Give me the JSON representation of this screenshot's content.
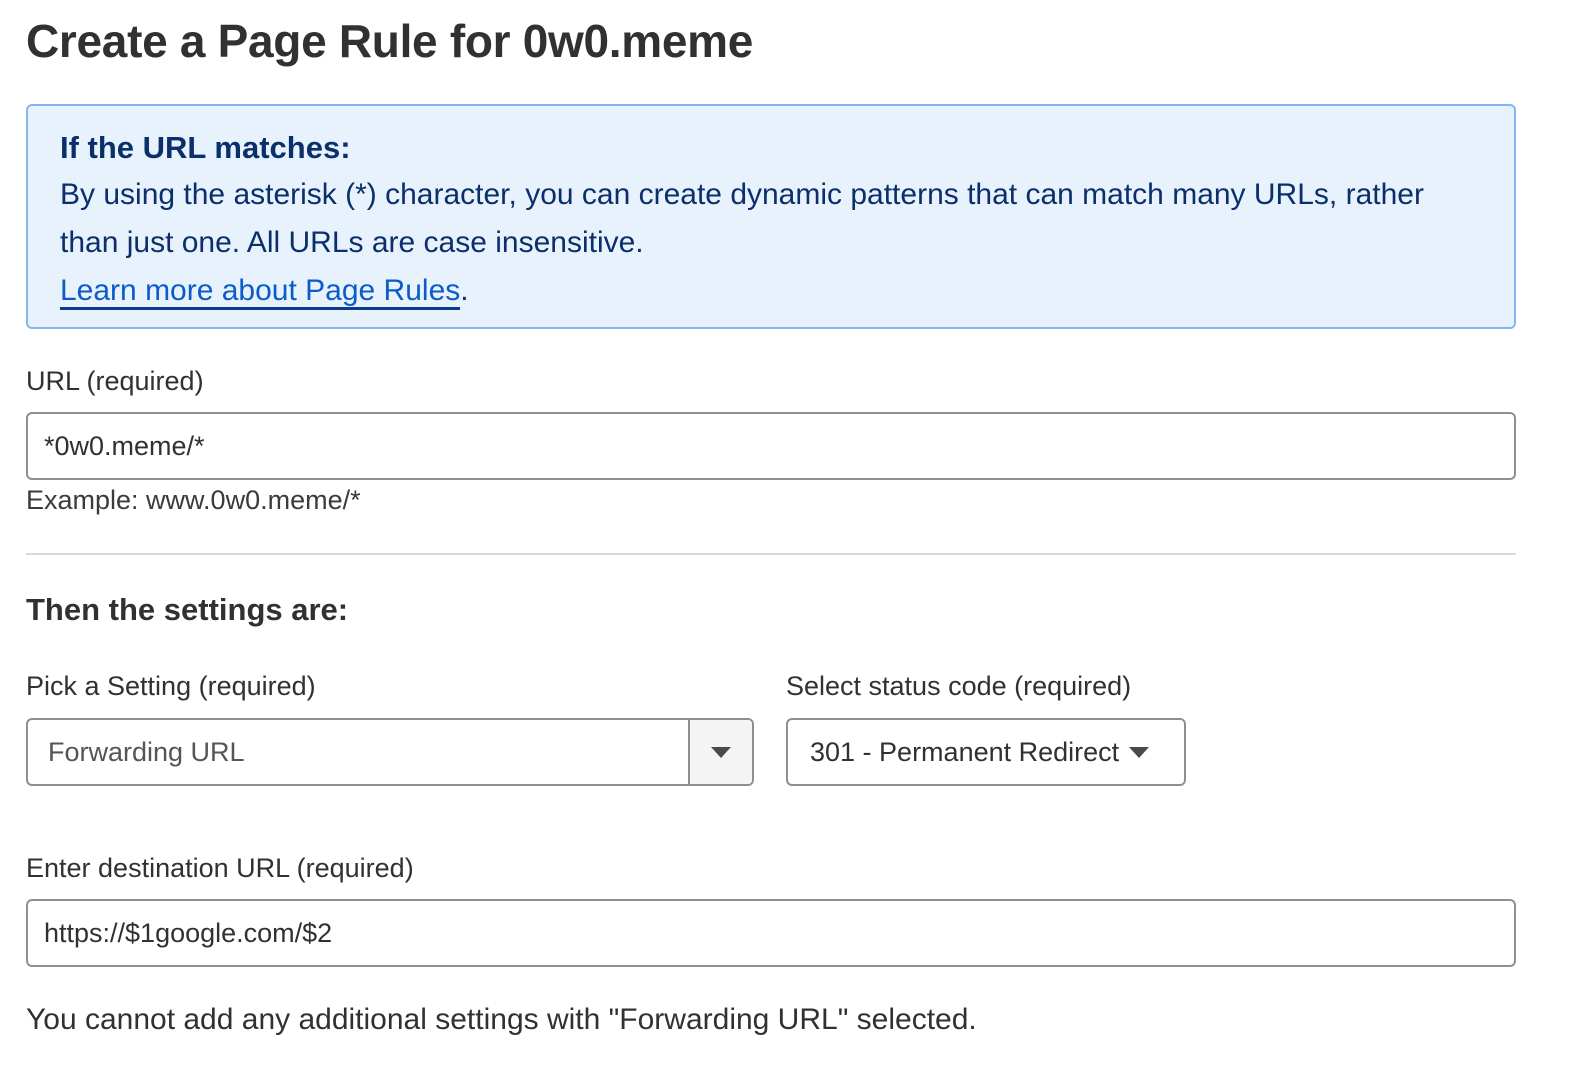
{
  "page": {
    "title": "Create a Page Rule for 0w0.meme"
  },
  "info_box": {
    "heading": "If the URL matches:",
    "body": "By using the asterisk (*) character, you can create dynamic patterns that can match many URLs, rather than just one. All URLs are case insensitive.",
    "link_text": "Learn more about Page Rules",
    "link_suffix": "."
  },
  "url_field": {
    "label": "URL (required)",
    "value": "*0w0.meme/*",
    "hint": "Example: www.0w0.meme/*"
  },
  "settings": {
    "heading": "Then the settings are:",
    "setting_select": {
      "label": "Pick a Setting (required)",
      "selected": "Forwarding URL",
      "icon": "caret-down-icon"
    },
    "status_select": {
      "label": "Select status code (required)",
      "selected": "301 - Permanent Redirect",
      "icon": "caret-down-icon"
    },
    "destination_field": {
      "label": "Enter destination URL (required)",
      "value": "https://$1google.com/$2"
    },
    "note": "You cannot add any additional settings with \"Forwarding URL\" selected."
  },
  "colors": {
    "info_background": "#e8f2fd",
    "info_border": "#83b6ef",
    "info_text": "#0b2f6b",
    "link": "#0b5bc8"
  }
}
